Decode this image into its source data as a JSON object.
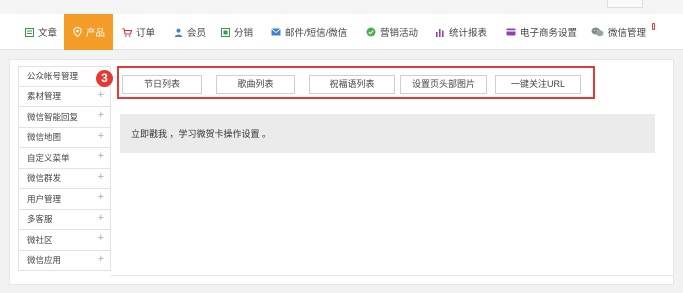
{
  "nav": {
    "items": [
      {
        "label": "文章",
        "icon": "document-icon"
      },
      {
        "label": "产品",
        "icon": "location-pin-icon",
        "active": true
      },
      {
        "label": "订单",
        "icon": "cart-icon"
      },
      {
        "label": "会员",
        "icon": "user-icon"
      },
      {
        "label": "分销",
        "icon": "distribution-icon"
      },
      {
        "label": "邮件/短信/微信",
        "icon": "mail-icon"
      },
      {
        "label": "营销活动",
        "icon": "marketing-icon"
      },
      {
        "label": "统计报表",
        "icon": "bar-chart-icon"
      },
      {
        "label": "电子商务设置",
        "icon": "card-icon"
      },
      {
        "label": "微信管理",
        "icon": "wechat-icon"
      }
    ],
    "accent_color": "#f39c28"
  },
  "sidebar": {
    "items": [
      {
        "label": "公众帐号管理"
      },
      {
        "label": "素材管理"
      },
      {
        "label": "微信智能回复"
      },
      {
        "label": "微信地图"
      },
      {
        "label": "自定义菜单"
      },
      {
        "label": "微信群发"
      },
      {
        "label": "用户管理"
      },
      {
        "label": "多客服"
      },
      {
        "label": "微社区"
      },
      {
        "label": "微信应用"
      }
    ]
  },
  "step_marker": "3",
  "toolbar": {
    "buttons": [
      {
        "label": "节日列表"
      },
      {
        "label": "歌曲列表"
      },
      {
        "label": "祝福语列表"
      },
      {
        "label": "设置页头部图片"
      },
      {
        "label": "一键关注URL"
      }
    ]
  },
  "notice": {
    "text": "立即戳我 ，学习微贺卡操作设置 。"
  },
  "colors": {
    "highlight_red": "#e53935"
  }
}
